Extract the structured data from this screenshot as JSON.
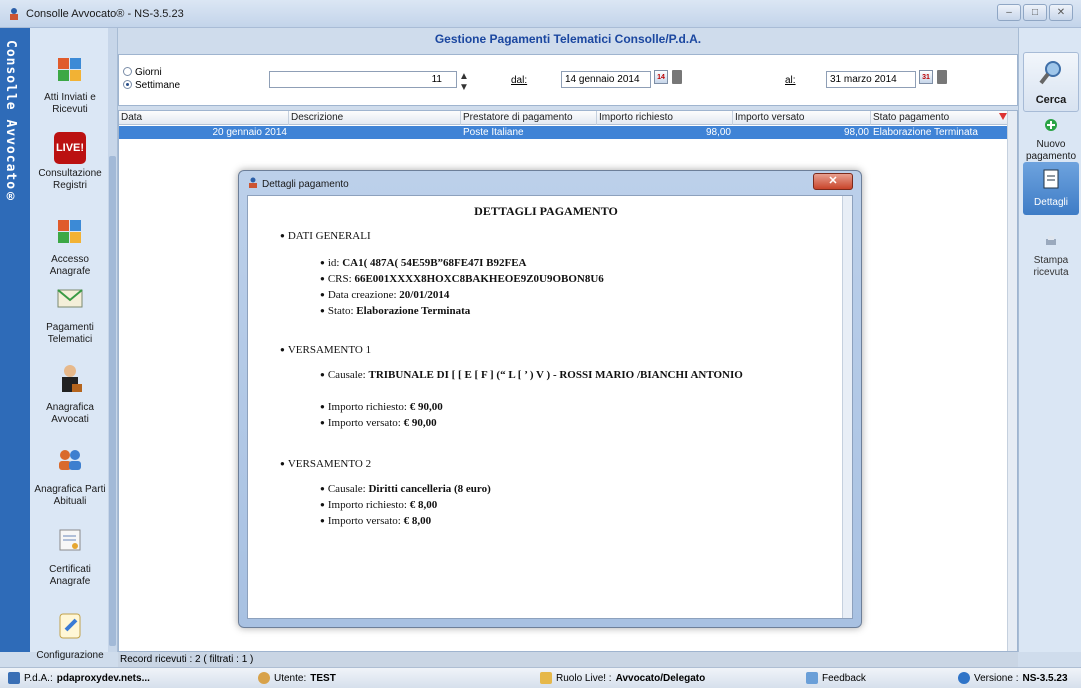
{
  "window": {
    "title": "Consolle Avvocato® - NS-3.5.23",
    "brand_strip": "Consolle Avvocato®"
  },
  "header": {
    "title": "Gestione Pagamenti Telematici Consolle/P.d.A."
  },
  "filter": {
    "radio_giorni": "Giorni",
    "radio_settimane": "Settimane",
    "selected": "Settimane",
    "count_value": "11",
    "dal_label": "dal:",
    "dal_value": "14 gennaio 2014",
    "al_label": "al:",
    "al_value": "31 marzo 2014"
  },
  "left_nav": [
    {
      "label": "Atti Inviati e Ricevuti"
    },
    {
      "label": "Consultazione Registri"
    },
    {
      "label": "Accesso Anagrafe"
    },
    {
      "label": "Pagamenti Telematici"
    },
    {
      "label": "Anagrafica Avvocati"
    },
    {
      "label": "Anagrafica Parti Abituali"
    },
    {
      "label": "Certificati Anagrafe"
    },
    {
      "label": "Configurazione"
    }
  ],
  "live_badge": "LIVE!",
  "right_bar": {
    "search": "Cerca",
    "new_payment": "Nuovo pagamento",
    "details": "Dettagli",
    "print_receipt": "Stampa ricevuta"
  },
  "grid": {
    "columns": [
      "Data",
      "Descrizione",
      "Prestatore di pagamento",
      "Importo richiesto",
      "Importo versato",
      "Stato pagamento"
    ],
    "rows": [
      [
        "20 gennaio 2014",
        "",
        "Poste Italiane",
        "98,00",
        "98,00",
        "Elaborazione Terminata"
      ]
    ]
  },
  "records_text": "Record ricevuti : 2 ( filtrati : 1 )",
  "statusbar": {
    "pda_label": "P.d.A.:",
    "pda_value": "pdaproxydev.nets...",
    "user_label": "Utente:",
    "user_value": "TEST",
    "role_label": "Ruolo Live! :",
    "role_value": "Avvocato/Delegato",
    "feedback": "Feedback",
    "version_label": "Versione :",
    "version_value": "NS-3.5.23"
  },
  "dialog": {
    "title": "Dettagli pagamento",
    "doc_title": "DETTAGLI PAGAMENTO",
    "general": {
      "heading": "DATI GENERALI",
      "id_label": "id:",
      "id_value": "CA1( 487A( 54E59B”68FE47I B92FEA",
      "crs_label": "CRS:",
      "crs_value": "66E001XXXX8HOXC8BAKHEOE9Z0U9OBON8U6",
      "date_label": "Data creazione:",
      "date_value": "20/01/2014",
      "state_label": "Stato:",
      "state_value": "Elaborazione Terminata"
    },
    "payment1": {
      "heading": "VERSAMENTO 1",
      "causale_label": "Causale:",
      "causale_value": "TRIBUNALE DI [ [ E [ F ] (“ L [ ’ ) V ) - ROSSI MARIO /BIANCHI ANTONIO",
      "richiesto_label": "Importo richiesto:",
      "richiesto_value": "€ 90,00",
      "versato_label": "Importo versato:",
      "versato_value": "€ 90,00"
    },
    "payment2": {
      "heading": "VERSAMENTO 2",
      "causale_label": "Causale:",
      "causale_value": "Diritti cancelleria (8 euro)",
      "richiesto_label": "Importo richiesto:",
      "richiesto_value": "€ 8,00",
      "versato_label": "Importo versato:",
      "versato_value": "€ 8,00"
    }
  }
}
